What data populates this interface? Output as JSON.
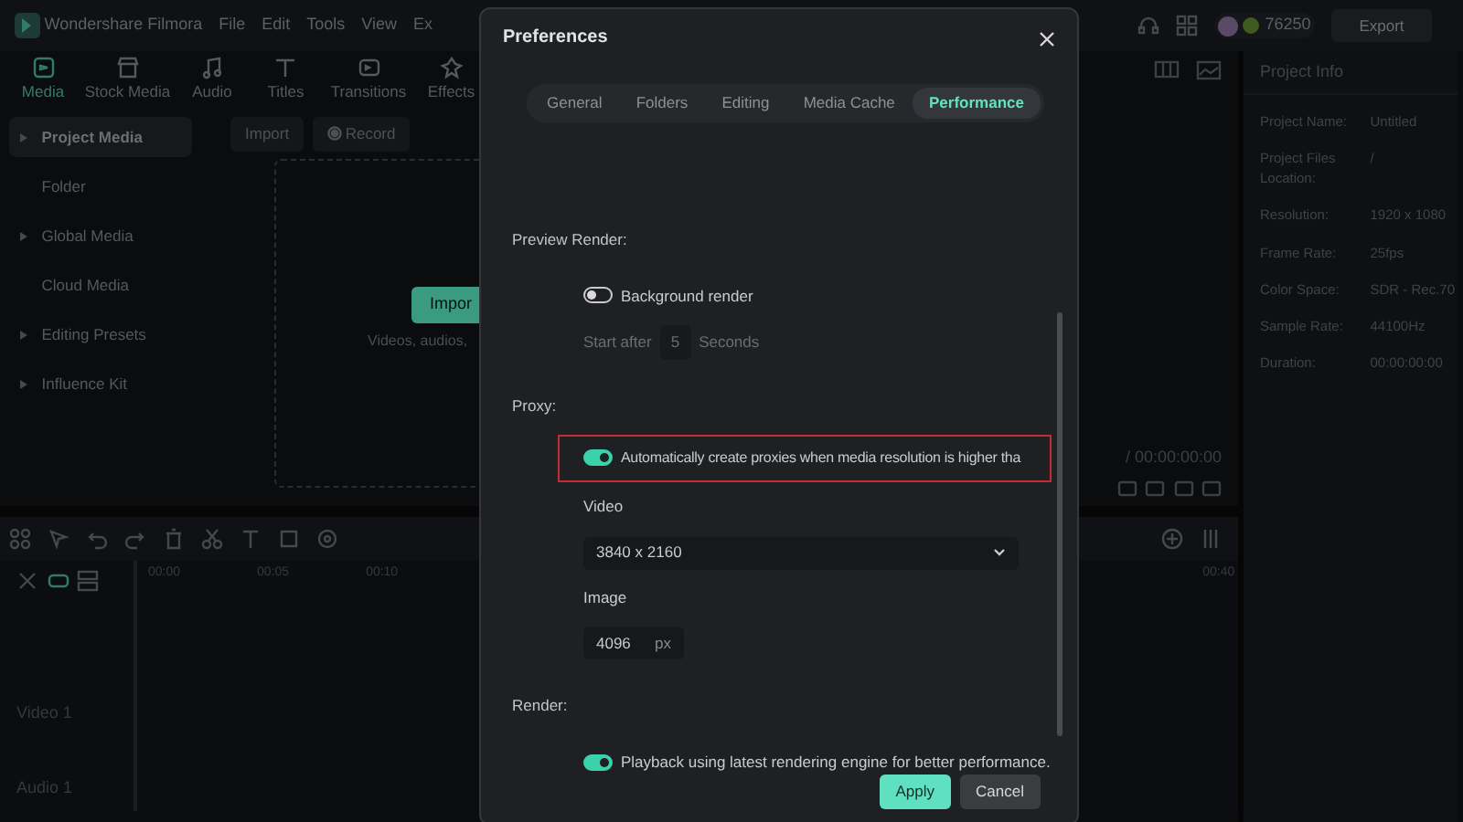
{
  "app": {
    "title": "Wondershare Filmora",
    "menu": [
      "File",
      "Edit",
      "Tools",
      "View",
      "Ex"
    ]
  },
  "account": {
    "credits": "76250",
    "export_button": "Export"
  },
  "media_tabs": [
    {
      "label": "Media",
      "selected": true
    },
    {
      "label": "Stock Media",
      "selected": false
    },
    {
      "label": "Audio",
      "selected": false
    },
    {
      "label": "Titles",
      "selected": false
    },
    {
      "label": "Transitions",
      "selected": false
    },
    {
      "label": "Effects",
      "selected": false
    }
  ],
  "media_toolbar": {
    "import": "Import",
    "record": "Record"
  },
  "sidebar": {
    "items": [
      {
        "label": "Project Media",
        "selected": true,
        "expandable": true
      },
      {
        "label": "Folder",
        "selected": false,
        "expandable": false
      },
      {
        "label": "Global Media",
        "selected": false,
        "expandable": true
      },
      {
        "label": "Cloud Media",
        "selected": false,
        "expandable": false
      },
      {
        "label": "Editing Presets",
        "selected": false,
        "expandable": true
      },
      {
        "label": "Influence Kit",
        "selected": false,
        "expandable": true
      }
    ]
  },
  "import_area": {
    "button": "Impor",
    "hint": "Videos, audios,"
  },
  "player": {
    "time_total": "/ 00:00:00:00"
  },
  "timeline": {
    "ruler": [
      "00:00",
      "00:05",
      "00:10",
      "00:40"
    ],
    "tracks": [
      "Video 1",
      "Audio 1"
    ]
  },
  "project_info": {
    "title": "Project Info",
    "fields": [
      {
        "label": "Project Name:",
        "value": "Untitled"
      },
      {
        "label": "Project Files Location:",
        "value": "/"
      },
      {
        "label": "Resolution:",
        "value": "1920 x 1080"
      },
      {
        "label": "Frame Rate:",
        "value": "25fps"
      },
      {
        "label": "Color Space:",
        "value": "SDR - Rec.70"
      },
      {
        "label": "Sample Rate:",
        "value": "44100Hz"
      },
      {
        "label": "Duration:",
        "value": "00:00:00:00"
      }
    ]
  },
  "dialog": {
    "title": "Preferences",
    "tabs": [
      {
        "label": "General",
        "selected": false
      },
      {
        "label": "Folders",
        "selected": false
      },
      {
        "label": "Editing",
        "selected": false
      },
      {
        "label": "Media Cache",
        "selected": false
      },
      {
        "label": "Performance",
        "selected": true
      }
    ],
    "sections": [
      {
        "heading": "Preview Render:",
        "rows": [
          {
            "kind": "toggle",
            "label": "Background render",
            "on": false
          },
          {
            "kind": "delay",
            "label": "Start after",
            "value": "5",
            "unit": "Seconds",
            "disabled": true
          }
        ]
      },
      {
        "heading": "Proxy:",
        "rows": [
          {
            "kind": "toggle",
            "label": "Automatically create proxies when media resolution is higher tha",
            "on": true,
            "highlighted": true
          },
          {
            "kind": "select",
            "label": "Video",
            "value": "3840 x 2160"
          },
          {
            "kind": "number",
            "label": "Image",
            "value": "4096",
            "unit": "px"
          }
        ]
      },
      {
        "heading": "Render:",
        "rows": [
          {
            "kind": "toggle",
            "label": "Playback using latest rendering engine for better performance.",
            "on": true
          }
        ]
      }
    ],
    "buttons": [
      {
        "label": "Apply",
        "primary": true
      },
      {
        "label": "Cancel",
        "primary": false
      }
    ]
  }
}
